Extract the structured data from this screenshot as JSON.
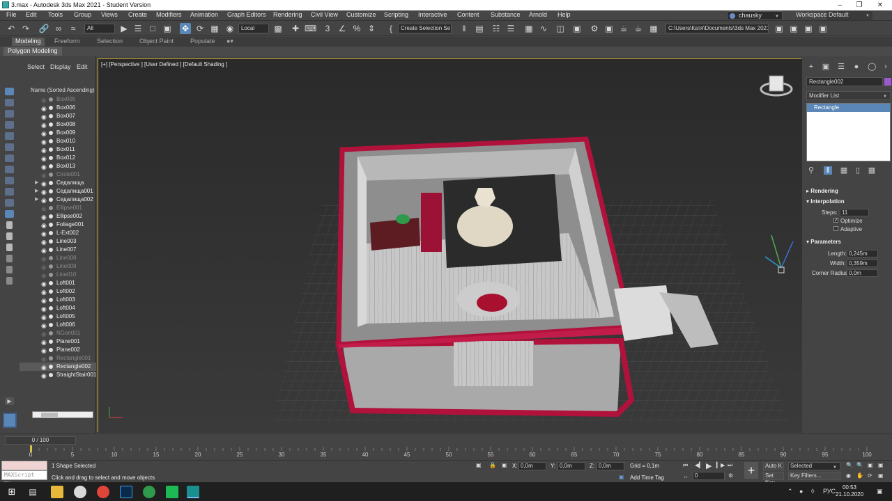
{
  "window": {
    "title": "3.max - Autodesk 3ds Max 2021 - Student Version"
  },
  "menu": [
    "File",
    "Edit",
    "Tools",
    "Group",
    "Views",
    "Create",
    "Modifiers",
    "Animation",
    "Graph Editors",
    "Rendering",
    "Civil View",
    "Customize",
    "Scripting",
    "Interactive",
    "Content",
    "Substance",
    "Arnold",
    "Help"
  ],
  "account": {
    "user": "chausky",
    "workspaces_label": "Workspaces:",
    "workspace": "Default"
  },
  "toolbar": {
    "filter": "All",
    "ref_coord": "Local",
    "selection_set": "Create Selection Se",
    "project_path": "C:\\Users\\Катя\\Documents\\3ds Max 2021"
  },
  "ribbon": {
    "tabs": [
      "Modeling",
      "Freeform",
      "Selection",
      "Object Paint",
      "Populate"
    ],
    "active": "Modeling",
    "panel": "Polygon Modeling"
  },
  "explorer": {
    "tabs": [
      "Select",
      "Display",
      "Edit"
    ],
    "header": "Name (Sorted Ascending)",
    "rows": [
      {
        "name": "Box005",
        "hidden": true
      },
      {
        "name": "Box006"
      },
      {
        "name": "Box007"
      },
      {
        "name": "Box008"
      },
      {
        "name": "Box009"
      },
      {
        "name": "Box010"
      },
      {
        "name": "Box011"
      },
      {
        "name": "Box012"
      },
      {
        "name": "Box013"
      },
      {
        "name": "Circle001",
        "hidden": true
      },
      {
        "name": "Седалища",
        "expand": true
      },
      {
        "name": "Седалища001",
        "expand": true
      },
      {
        "name": "Седалища002",
        "expand": true
      },
      {
        "name": "Ellipse001",
        "hidden": true
      },
      {
        "name": "Ellipse002"
      },
      {
        "name": "Foliage001"
      },
      {
        "name": "L-Ext002"
      },
      {
        "name": "Line003"
      },
      {
        "name": "Line007"
      },
      {
        "name": "Line008",
        "hidden": true
      },
      {
        "name": "Line009",
        "hidden": true
      },
      {
        "name": "Line010",
        "hidden": true
      },
      {
        "name": "Loft001"
      },
      {
        "name": "Loft002"
      },
      {
        "name": "Loft003"
      },
      {
        "name": "Loft004"
      },
      {
        "name": "Loft005"
      },
      {
        "name": "Loft006"
      },
      {
        "name": "NGon001",
        "hidden": true
      },
      {
        "name": "Plane001"
      },
      {
        "name": "Plane002"
      },
      {
        "name": "Rectangle001",
        "hidden": true
      },
      {
        "name": "Rectangle002",
        "selected": true
      },
      {
        "name": "StraightStair001"
      }
    ]
  },
  "viewport": {
    "label": "[+] [Perspective ] [User Defined ] [Default Shading ]"
  },
  "command_panel": {
    "object_name": "Rectangle002",
    "modifier_list": "Modifier List",
    "stack_item": "Rectangle",
    "rollouts": {
      "rendering": "Rendering",
      "interpolation": "Interpolation",
      "parameters": "Parameters"
    },
    "steps_label": "Steps:",
    "steps": "11",
    "optimize": "Optimize",
    "adaptive": "Adaptive",
    "length_label": "Length:",
    "length": "0,245m",
    "width_label": "Width:",
    "width": "0,359m",
    "corner_label": "Corner Radius:",
    "corner": "0,0m"
  },
  "timeline": {
    "frame": "0 / 100",
    "ticks": [
      "0",
      "5",
      "10",
      "15",
      "20",
      "25",
      "30",
      "35",
      "40",
      "45",
      "50",
      "55",
      "60",
      "65",
      "70",
      "75",
      "80",
      "85",
      "90",
      "95",
      "100"
    ]
  },
  "status": {
    "maxscript": "MAXScript Mi:",
    "selected": "1 Shape Selected",
    "prompt": "Click and drag to select and move objects",
    "x_label": "X:",
    "x": "0,0m",
    "y_label": "Y:",
    "y": "0,0m",
    "z_label": "Z:",
    "z": "0,0m",
    "grid": "Grid = 0,1m",
    "add_time_tag": "Add Time Tag",
    "frame_field": "0",
    "auto_key": "Auto K",
    "selected_dd": "Selected",
    "set_key": "Set Key",
    "key_filters": "Key Filters..."
  },
  "taskbar": {
    "lang": "РУС",
    "time": "00:53",
    "date": "21.10.2020"
  }
}
